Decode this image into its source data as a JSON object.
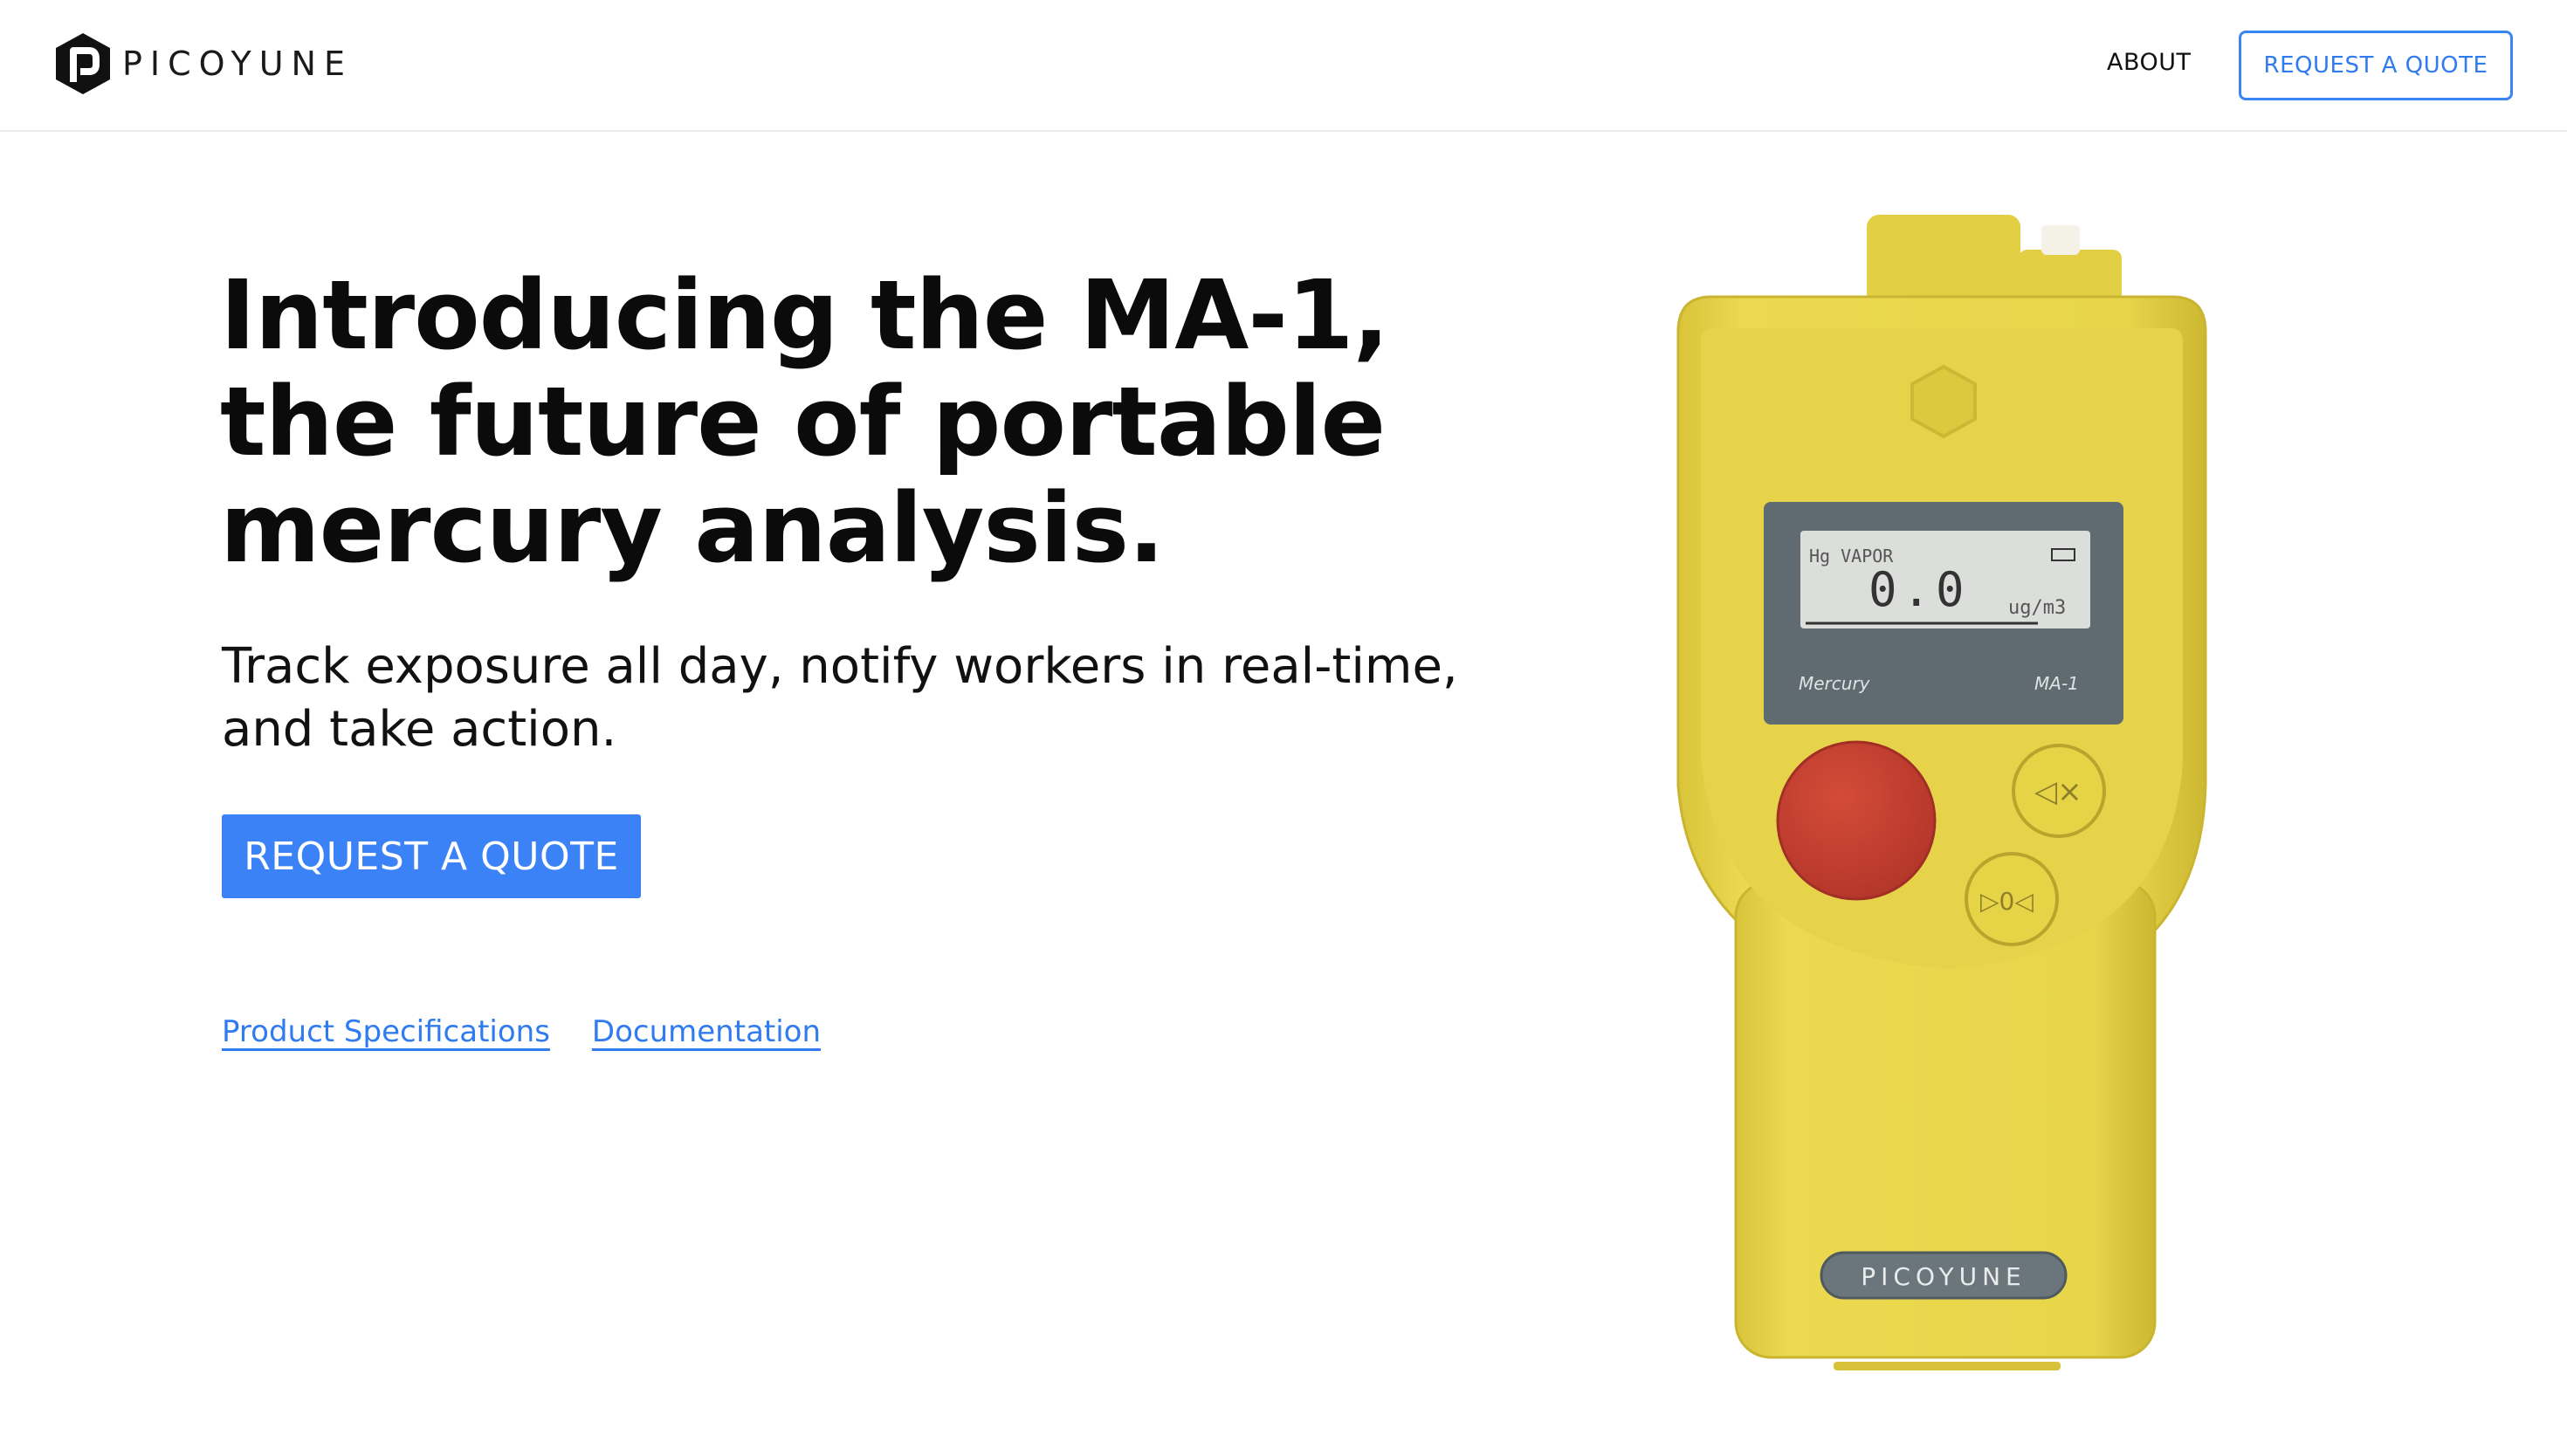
{
  "brand": {
    "name": "PICOYUNE"
  },
  "nav": {
    "about": "ABOUT",
    "quote": "REQUEST A QUOTE"
  },
  "hero": {
    "headline_lines": [
      "Introducing the MA-1,",
      "the future of portable",
      "mercury analysis."
    ],
    "subhead_lines": [
      "Track exposure all day, notify workers in real-time,",
      "and take action."
    ],
    "cta": "REQUEST A QUOTE",
    "links": [
      "Product Specifications",
      "Documentation"
    ]
  },
  "device": {
    "screen_label": "Hg VAPOR",
    "reading": "0.0",
    "unit": "ug/m3",
    "footer_left": "Mercury",
    "footer_right": "MA-1",
    "plate": "PICOYUNE",
    "mute_symbol": "◁×",
    "zero_symbol": "▷0◁"
  },
  "colors": {
    "accent": "#3b82f6",
    "device_yellow": "#e8d54a",
    "alarm_red": "#c8402e",
    "screen_bezel": "#5f6b70"
  }
}
